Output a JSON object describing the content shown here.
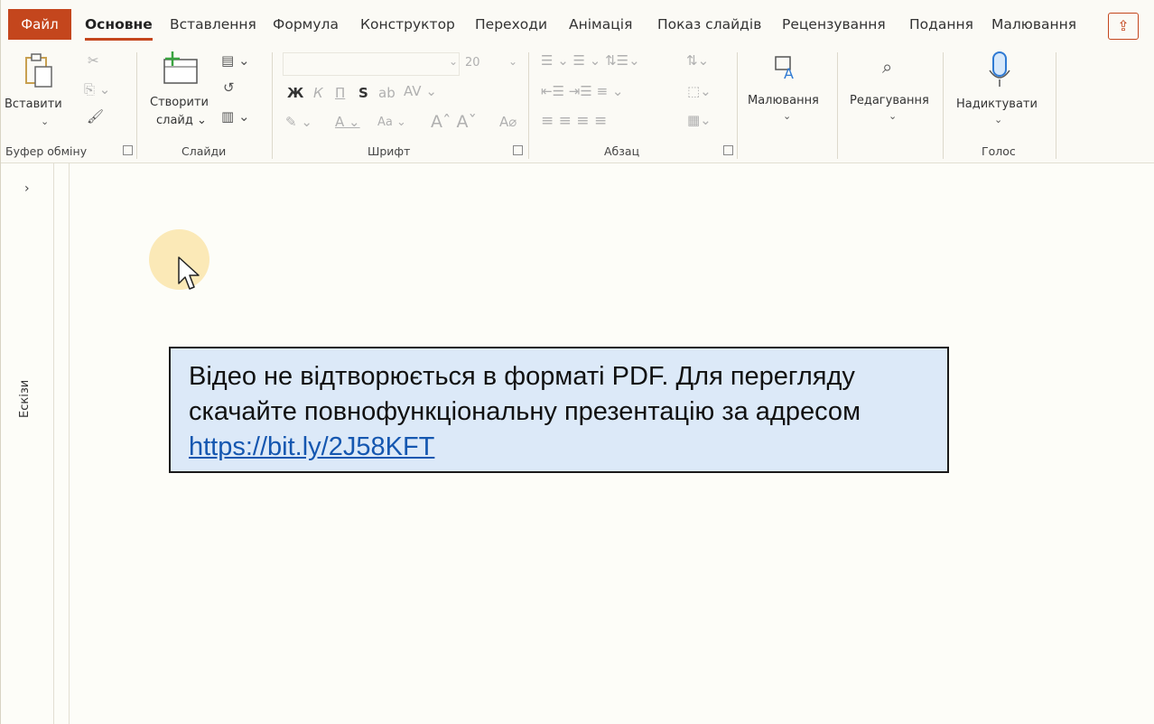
{
  "tabs": {
    "file": "Файл",
    "items": [
      "Основне",
      "Вставлення",
      "Формула",
      "Конструктор",
      "Переходи",
      "Анімація",
      "Показ слайдів",
      "Рецензування",
      "Подання",
      "Малювання"
    ]
  },
  "ribbon": {
    "paste": "Вставити",
    "clipboard_group": "Буфер обміну",
    "new_slide_1": "Створити",
    "new_slide_2": "слайд",
    "slides_group": "Слайди",
    "font_size": "20",
    "bold": "Ж",
    "italic": "К",
    "underline": "П",
    "strike": "S",
    "case": "Aa",
    "font_group": "Шрифт",
    "paragraph_group": "Абзац",
    "drawing": "Малювання",
    "editing": "Редагування",
    "dictate": "Надиктувати",
    "voice_group": "Голос"
  },
  "left_pane": {
    "expand": "›",
    "label": "Ескізи"
  },
  "note": {
    "line1": "Відео не відтворюється в форматі PDF. Для перегляду",
    "line2": "скачайте повнофункціональну презентацію за адресом",
    "link": "https://bit.ly/2J58KFT"
  },
  "colors": {
    "accent": "#c4461d",
    "note_bg": "#dce9f8",
    "link": "#1557b0"
  }
}
